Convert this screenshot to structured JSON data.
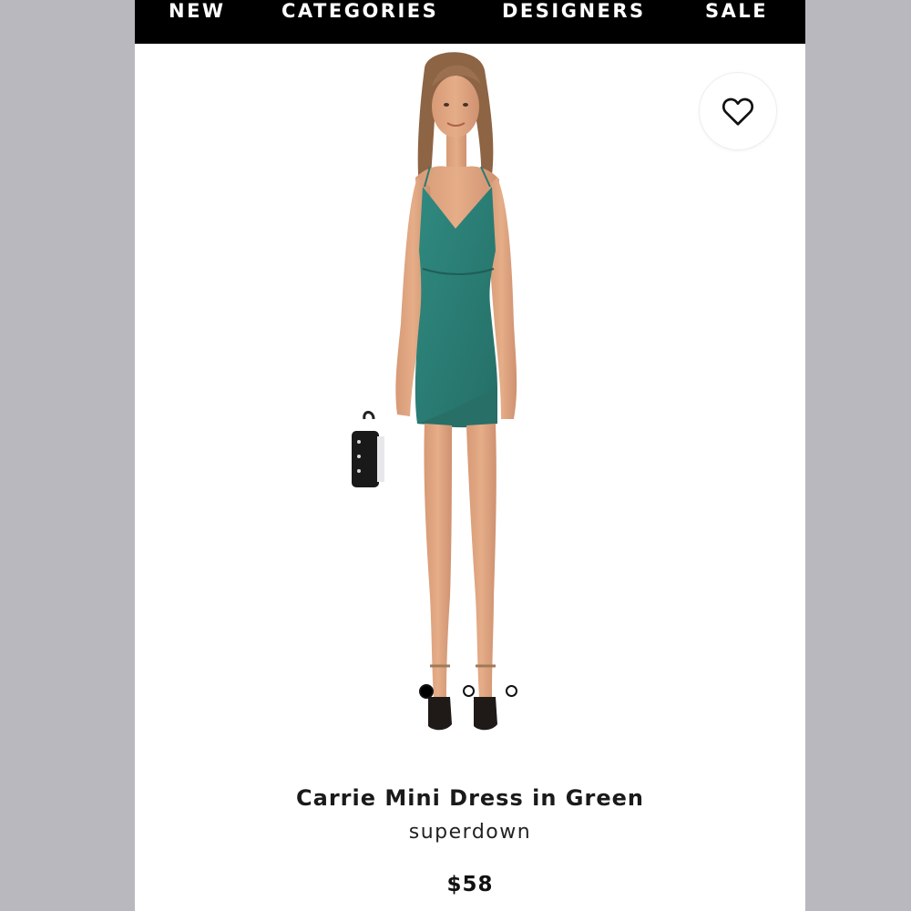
{
  "nav": {
    "items": [
      {
        "label": "NEW"
      },
      {
        "label": "CATEGORIES"
      },
      {
        "label": "DESIGNERS"
      },
      {
        "label": "SALE"
      }
    ]
  },
  "product": {
    "name": "Carrie Mini Dress in Green",
    "brand": "superdown",
    "price": "$58",
    "image_count": 3,
    "active_image": 1,
    "dress_color": "#2f8a80"
  },
  "icons": {
    "favorite": "heart-outline-icon"
  },
  "colors": {
    "nav_background": "#000000",
    "page_background": "#ffffff",
    "side_background": "#b8b8be"
  }
}
